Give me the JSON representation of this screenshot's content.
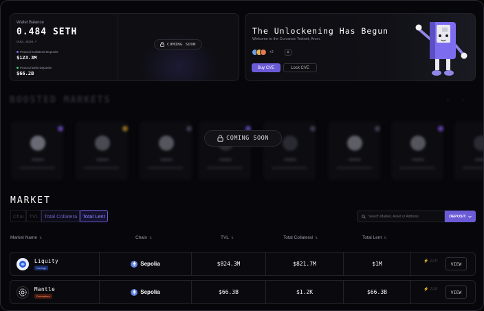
{
  "wallet": {
    "label": "Wallet Balance",
    "balance": "0.484 SETH",
    "address": "0x9a...8D94 ↗",
    "collateral_label": "Protocol Collateral Deposits",
    "collateral_value": "$123.3M",
    "debt_label": "Protocol Debt Deposits",
    "debt_value": "$66.2B",
    "coming_soon": "COMING SOON",
    "colors": {
      "collateral_dot": "#7b6cf0",
      "debt_dot": "#3ecf6e"
    }
  },
  "unlock": {
    "title": "The Unlockening Has Begun",
    "subtitle": "Welcome to the Curvance Testnet, Anon.",
    "avatar_more": "+2",
    "plus_label": "+",
    "buy_label": "Buy CVE",
    "lock_label": "Lock CVE",
    "mascot_icon": "mascot-robot-icon"
  },
  "boosted": {
    "title": "BOOSTED MARKETS",
    "coming_soon": "COMING SOON"
  },
  "market": {
    "title": "MARKET",
    "tabs": [
      "Chai",
      "TVL",
      "Total Collatera",
      "Total Lent"
    ],
    "search_placeholder": "Search Market, Asset or Address",
    "deposit_label": "DEPOSIT",
    "columns": [
      "Market Name",
      "Chain",
      "TVL",
      "Total Collateral",
      "Total Lent"
    ],
    "rows": [
      {
        "name": "Liquity",
        "tag": "Savings",
        "chain": "Sepolia",
        "tvl": "$824.3M",
        "collateral": "$821.7M",
        "lent": "$1M",
        "zap": "⚡ ZAP",
        "view": "VIEW",
        "icon": "liquity-icon",
        "tag_color": "#2f57c9"
      },
      {
        "name": "Mantle",
        "tag": "Derivatives",
        "chain": "Sepolia",
        "tvl": "$66.3B",
        "collateral": "$1.2K",
        "lent": "$66.3B",
        "zap": "⚡ ZAP",
        "view": "VIEW",
        "icon": "mantle-icon",
        "tag_color": "#a43a1a"
      }
    ]
  },
  "theme": {
    "accent": "#6b5bd6",
    "background": "#07070b"
  }
}
